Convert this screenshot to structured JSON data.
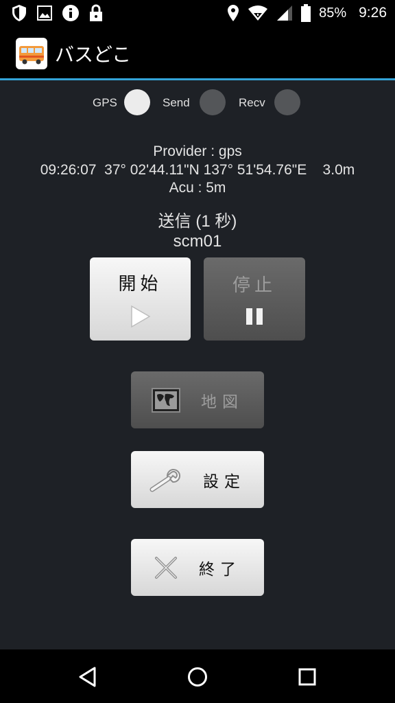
{
  "status_bar": {
    "battery_percent": "85%",
    "time": "9:26",
    "icons": [
      "shield-icon",
      "image-icon",
      "info-icon",
      "lock-icon",
      "location-icon",
      "wifi-icon",
      "signal-icon",
      "battery-icon"
    ]
  },
  "app_bar": {
    "title": "バスどこ",
    "icon": "bus-icon"
  },
  "indicators": [
    {
      "label": "GPS",
      "state": "on"
    },
    {
      "label": "Send",
      "state": "off"
    },
    {
      "label": "Recv",
      "state": "off"
    }
  ],
  "info": {
    "provider": "Provider : gps",
    "coordinates": "09:26:07  37° 02'44.11\"N 137° 51'54.76\"E    3.0m",
    "accuracy": "Acu : 5m",
    "send_status": "送信 (1 秒)",
    "user_id": "scm01"
  },
  "buttons": {
    "start": {
      "label": "開始",
      "icon": "play-icon",
      "enabled": true
    },
    "stop": {
      "label": "停止",
      "icon": "pause-icon",
      "enabled": false
    },
    "map": {
      "label": "地図",
      "icon": "map-icon",
      "enabled": false
    },
    "settings": {
      "label": "設定",
      "icon": "wrench-icon",
      "enabled": true
    },
    "exit": {
      "label": "終了",
      "icon": "close-icon",
      "enabled": true
    }
  },
  "nav_bar": {
    "icons": [
      "back-icon",
      "home-icon",
      "recents-icon"
    ]
  },
  "colors": {
    "accent": "#33a4d8",
    "background": "#1e2126",
    "indicator_on": "#ececec",
    "indicator_off": "#545659"
  }
}
